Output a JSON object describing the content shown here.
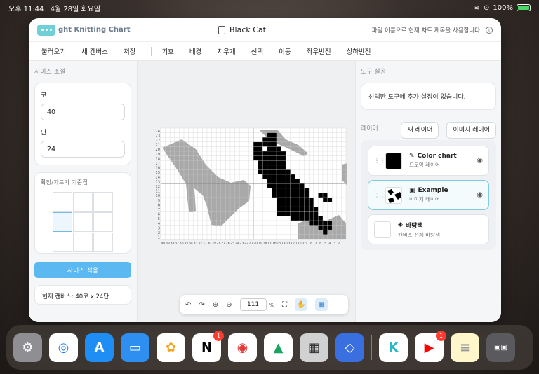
{
  "status": {
    "time": "오후 11:44",
    "date": "4월 28일 화요일",
    "battery": "100%"
  },
  "app": {
    "title": "ght Knitting Chart",
    "doc_name": "Black Cat",
    "hint": "파일 이름으로 현재 차트 제목을 사용합니다"
  },
  "menu": [
    "불러오기",
    "새 캔버스",
    "저장",
    "기호",
    "배경",
    "지우개",
    "선택",
    "이동",
    "좌우반전",
    "상하반전"
  ],
  "left": {
    "section": "사이즈 조절",
    "stitch_label": "코",
    "stitch_value": "40",
    "row_label": "단",
    "row_value": "24",
    "anchor_label": "확장/자르기 기준점",
    "apply": "사이즈 적용",
    "canvas_info": "현재 캔버스: 40코 x 24단"
  },
  "toolbar": {
    "zoom": "111",
    "pct": "%"
  },
  "right": {
    "section": "도구 설정",
    "note": "선택한 도구에 추가 설정이 없습니다.",
    "layer_label": "레이어",
    "new_layer": "새 레이어",
    "image_layer": "이미지 레이어",
    "layers": [
      {
        "name": "Color chart",
        "sub": "드로잉 레이어"
      },
      {
        "name": "Example",
        "sub": "이미지 레이어"
      },
      {
        "name": "바탕색",
        "sub": "캔버스 전체 바탕색"
      }
    ]
  },
  "chart_data": {
    "type": "heatmap",
    "cols": 40,
    "rows": 24,
    "row_labels": [
      "24",
      "23",
      "22",
      "21",
      "20",
      "19",
      "18",
      "17",
      "16",
      "15",
      "14",
      "13",
      "12",
      "11",
      "10",
      "9",
      "8",
      "7",
      "6",
      "5",
      "4",
      "3",
      "2",
      "1"
    ],
    "col_labels": [
      "40",
      "39",
      "38",
      "37",
      "36",
      "35",
      "34",
      "33",
      "32",
      "31",
      "30",
      "29",
      "28",
      "27",
      "26",
      "25",
      "24",
      "23",
      "22",
      "21",
      "20",
      "19",
      "18",
      "17",
      "16",
      "15",
      "14",
      "13",
      "12",
      "11",
      "10",
      "9",
      "8",
      "7",
      "6",
      "5",
      "4",
      "3",
      "2"
    ],
    "black_cells": [
      [
        22,
        2
      ],
      [
        22,
        3
      ],
      [
        23,
        1
      ],
      [
        23,
        2
      ],
      [
        23,
        3
      ],
      [
        23,
        4
      ],
      [
        24,
        1
      ],
      [
        24,
        2
      ],
      [
        24,
        3
      ],
      [
        24,
        4
      ],
      [
        24,
        5
      ],
      [
        20,
        3
      ],
      [
        20,
        4
      ],
      [
        21,
        3
      ],
      [
        21,
        4
      ],
      [
        21,
        5
      ],
      [
        21,
        6
      ],
      [
        22,
        5
      ],
      [
        22,
        6
      ],
      [
        23,
        5
      ],
      [
        23,
        6
      ],
      [
        24,
        6
      ],
      [
        25,
        4
      ],
      [
        25,
        5
      ],
      [
        25,
        6
      ],
      [
        25,
        7
      ],
      [
        26,
        5
      ],
      [
        26,
        6
      ],
      [
        26,
        7
      ],
      [
        26,
        8
      ],
      [
        20,
        5
      ],
      [
        20,
        6
      ],
      [
        21,
        7
      ],
      [
        22,
        7
      ],
      [
        22,
        8
      ],
      [
        23,
        7
      ],
      [
        23,
        8
      ],
      [
        23,
        9
      ],
      [
        24,
        7
      ],
      [
        24,
        8
      ],
      [
        24,
        9
      ],
      [
        24,
        10
      ],
      [
        25,
        8
      ],
      [
        25,
        9
      ],
      [
        25,
        10
      ],
      [
        25,
        11
      ],
      [
        26,
        9
      ],
      [
        26,
        10
      ],
      [
        26,
        11
      ],
      [
        26,
        12
      ],
      [
        27,
        9
      ],
      [
        27,
        10
      ],
      [
        27,
        11
      ],
      [
        27,
        12
      ],
      [
        27,
        13
      ],
      [
        28,
        10
      ],
      [
        28,
        11
      ],
      [
        28,
        12
      ],
      [
        28,
        13
      ],
      [
        28,
        14
      ],
      [
        29,
        11
      ],
      [
        29,
        12
      ],
      [
        29,
        13
      ],
      [
        29,
        14
      ],
      [
        29,
        15
      ],
      [
        30,
        12
      ],
      [
        30,
        13
      ],
      [
        30,
        14
      ],
      [
        30,
        15
      ],
      [
        30,
        16
      ],
      [
        31,
        13
      ],
      [
        31,
        14
      ],
      [
        31,
        15
      ],
      [
        31,
        16
      ],
      [
        31,
        17
      ],
      [
        21,
        8
      ],
      [
        21,
        9
      ],
      [
        22,
        9
      ],
      [
        22,
        10
      ],
      [
        23,
        10
      ],
      [
        23,
        11
      ],
      [
        23,
        12
      ],
      [
        24,
        11
      ],
      [
        24,
        12
      ],
      [
        24,
        13
      ],
      [
        24,
        14
      ],
      [
        25,
        12
      ],
      [
        25,
        13
      ],
      [
        25,
        14
      ],
      [
        25,
        15
      ],
      [
        26,
        13
      ],
      [
        26,
        14
      ],
      [
        26,
        15
      ],
      [
        27,
        14
      ],
      [
        27,
        15
      ],
      [
        27,
        16
      ],
      [
        28,
        15
      ],
      [
        28,
        16
      ],
      [
        28,
        17
      ],
      [
        29,
        16
      ],
      [
        29,
        17
      ],
      [
        29,
        18
      ],
      [
        29,
        19
      ],
      [
        30,
        17
      ],
      [
        30,
        18
      ],
      [
        30,
        19
      ],
      [
        31,
        18
      ],
      [
        31,
        19
      ],
      [
        32,
        15
      ],
      [
        32,
        16
      ],
      [
        32,
        17
      ],
      [
        32,
        18
      ],
      [
        32,
        19
      ],
      [
        32,
        20
      ],
      [
        33,
        17
      ],
      [
        33,
        18
      ],
      [
        33,
        19
      ],
      [
        33,
        20
      ],
      [
        34,
        19
      ],
      [
        34,
        20
      ],
      [
        34,
        21
      ],
      [
        35,
        20
      ],
      [
        35,
        21
      ],
      [
        35,
        22
      ],
      [
        36,
        20
      ],
      [
        36,
        21
      ],
      [
        34,
        14
      ],
      [
        35,
        14
      ],
      [
        35,
        15
      ],
      [
        36,
        15
      ],
      [
        27,
        17
      ],
      [
        27,
        18
      ],
      [
        28,
        18
      ],
      [
        28,
        19
      ],
      [
        26,
        16
      ],
      [
        26,
        17
      ],
      [
        25,
        16
      ],
      [
        25,
        17
      ],
      [
        25,
        18
      ],
      [
        26,
        18
      ]
    ],
    "legend": [
      "Color chart",
      "Example",
      "바탕색"
    ]
  }
}
